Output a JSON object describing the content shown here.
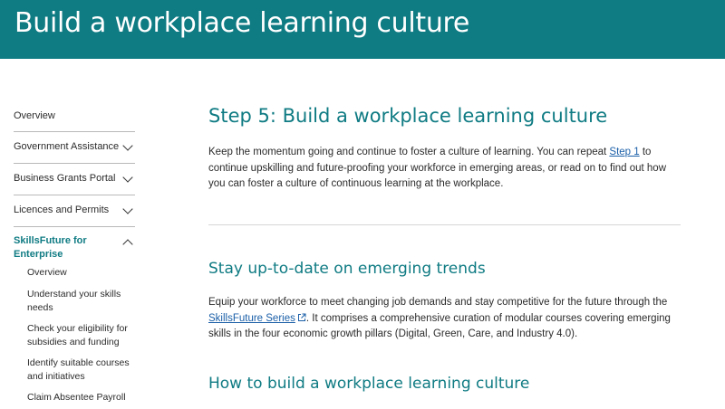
{
  "banner": {
    "title": "Build a workplace learning culture"
  },
  "sidebar": {
    "items": [
      {
        "label": "Overview"
      },
      {
        "label": "Government Assistance"
      },
      {
        "label": "Business Grants Portal"
      },
      {
        "label": "Licences and Permits"
      },
      {
        "label": "SkillsFuture for Enterprise"
      }
    ],
    "subitems": [
      {
        "label": "Overview"
      },
      {
        "label": "Understand your skills needs"
      },
      {
        "label": "Check your eligibility for subsidies and funding"
      },
      {
        "label": "Identify suitable courses and initiatives"
      },
      {
        "label": "Claim Absentee Payroll"
      }
    ]
  },
  "main": {
    "step_title": "Step 5: Build a workplace learning culture",
    "intro": {
      "before_link": "Keep the momentum going and continue to foster a culture of learning. You can repeat ",
      "link": "Step 1",
      "after_link": " to continue upskilling and future-proofing your workforce in emerging areas, or read on to find out how you can foster a culture of continuous learning at the workplace."
    },
    "section1": {
      "title": "Stay up-to-date on emerging trends",
      "before_link": "Equip your workforce to meet changing job demands and stay competitive for the future through the ",
      "link": "SkillsFuture Series",
      "after_link": ". It comprises a comprehensive curation of modular courses covering emerging skills in the four economic growth pillars (Digital, Green, Care, and Industry 4.0)."
    },
    "section2": {
      "title": "How to build a workplace learning culture"
    }
  },
  "colors": {
    "brand": "#0f7b83",
    "link": "#1a5fa8",
    "divider": "#d6d6d6"
  }
}
